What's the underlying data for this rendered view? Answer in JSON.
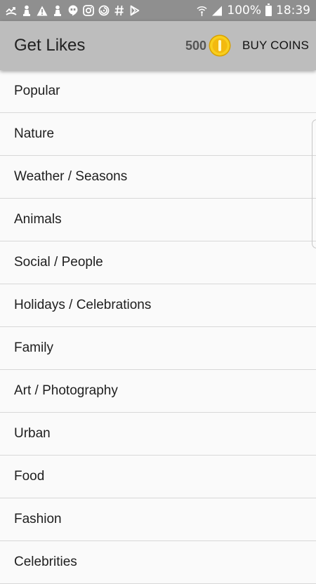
{
  "status_bar": {
    "battery": "100%",
    "time": "18:39",
    "notification_icons": [
      "missed-call-icon",
      "chess-pawn-icon",
      "warning-icon",
      "chess-pawn-icon",
      "hangouts-icon",
      "instagram-icon",
      "sync-icon",
      "hashtag-icon",
      "play-store-icon"
    ]
  },
  "app_bar": {
    "title": "Get Likes",
    "coin_count": "500",
    "buy_coins_label": "BUY COINS"
  },
  "categories": [
    "Popular",
    "Nature",
    "Weather / Seasons",
    "Animals",
    "Social / People",
    "Holidays / Celebrations",
    "Family",
    "Art / Photography",
    "Urban",
    "Food",
    "Fashion",
    "Celebrities"
  ],
  "colors": {
    "status_bar": "#8f8f8f",
    "app_bar": "#bdbdbd",
    "background": "#fafafa",
    "coin": "#f5c518"
  }
}
